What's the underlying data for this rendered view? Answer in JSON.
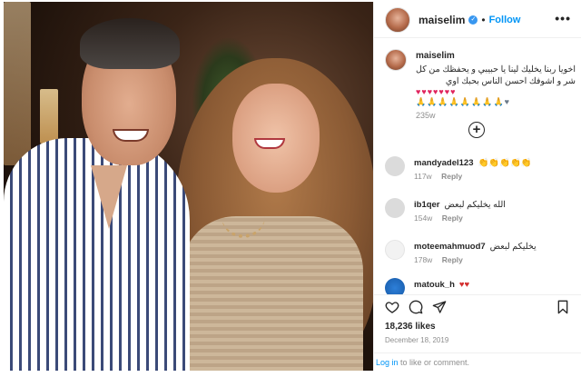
{
  "post": {
    "username": "maiselim",
    "follow_label": "Follow",
    "dot": "•",
    "more_icon_label": "•••"
  },
  "caption": {
    "username": "maiselim",
    "text": "اخويا ربنا يخليك لينا يا حبيبي و يحفظك من كل شر و اشوفك احسن الناس بحبك اوي",
    "hearts": "♥♥♥♥♥♥♥",
    "hands": "🙏🙏🙏🙏🙏🙏🙏🙏♥",
    "time": "235w"
  },
  "load_more_label": "+",
  "comments": [
    {
      "user": "mandyadel123",
      "text": "👏👏👏👏👏",
      "time": "117w",
      "reply": "Reply"
    },
    {
      "user": "ib1qer",
      "text": "الله يخليكم لبعض",
      "time": "154w",
      "reply": "Reply"
    },
    {
      "user": "moteemahmuod7",
      "text": "يخليكم لبعض",
      "time": "178w",
      "reply": "Reply"
    },
    {
      "user": "matouk_h",
      "text": "♥♥",
      "time": "",
      "reply": ""
    }
  ],
  "actions": {
    "like_icon": "heart-icon",
    "comment_icon": "comment-icon",
    "share_icon": "share-icon",
    "save_icon": "bookmark-icon"
  },
  "likes": "18,236 likes",
  "date": "December 18, 2019",
  "login": {
    "link": "Log in",
    "text": " to like or comment."
  }
}
